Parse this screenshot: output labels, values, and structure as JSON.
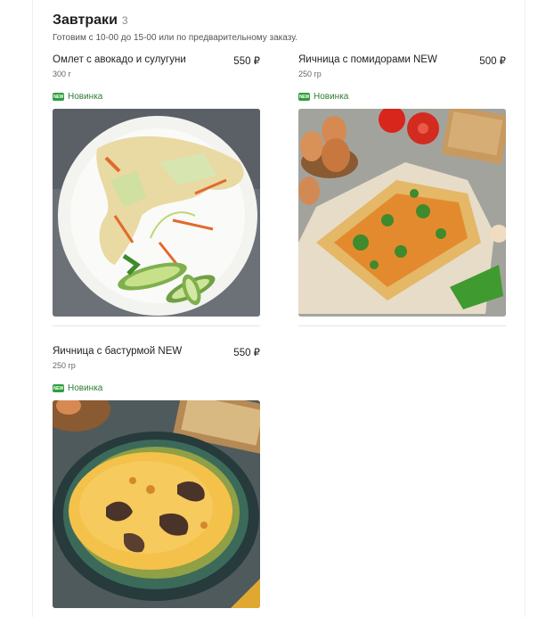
{
  "section": {
    "title": "Завтраки",
    "count": "3",
    "subtitle": "Готовим с 10-00 до 15-00 или по предварительному заказу."
  },
  "items": [
    {
      "name": "Омлет с авокадо и сулугуни",
      "price": "550 ₽",
      "weight": "300 г",
      "badge": "Новинка",
      "image_icon": "omelette-avocado-photo"
    },
    {
      "name": "Яичница с помидорами NEW",
      "price": "500 ₽",
      "weight": "250 гр",
      "badge": "Новинка",
      "image_icon": "eggs-tomatoes-photo"
    },
    {
      "name": "Яичница с бастурмой NEW",
      "price": "550 ₽",
      "weight": "250 гр",
      "badge": "Новинка",
      "image_icon": "eggs-basturma-photo"
    }
  ],
  "badge_icon_text": "NEW",
  "colors": {
    "badge_green": "#2e9e3d",
    "badge_text": "#2e7d32"
  }
}
